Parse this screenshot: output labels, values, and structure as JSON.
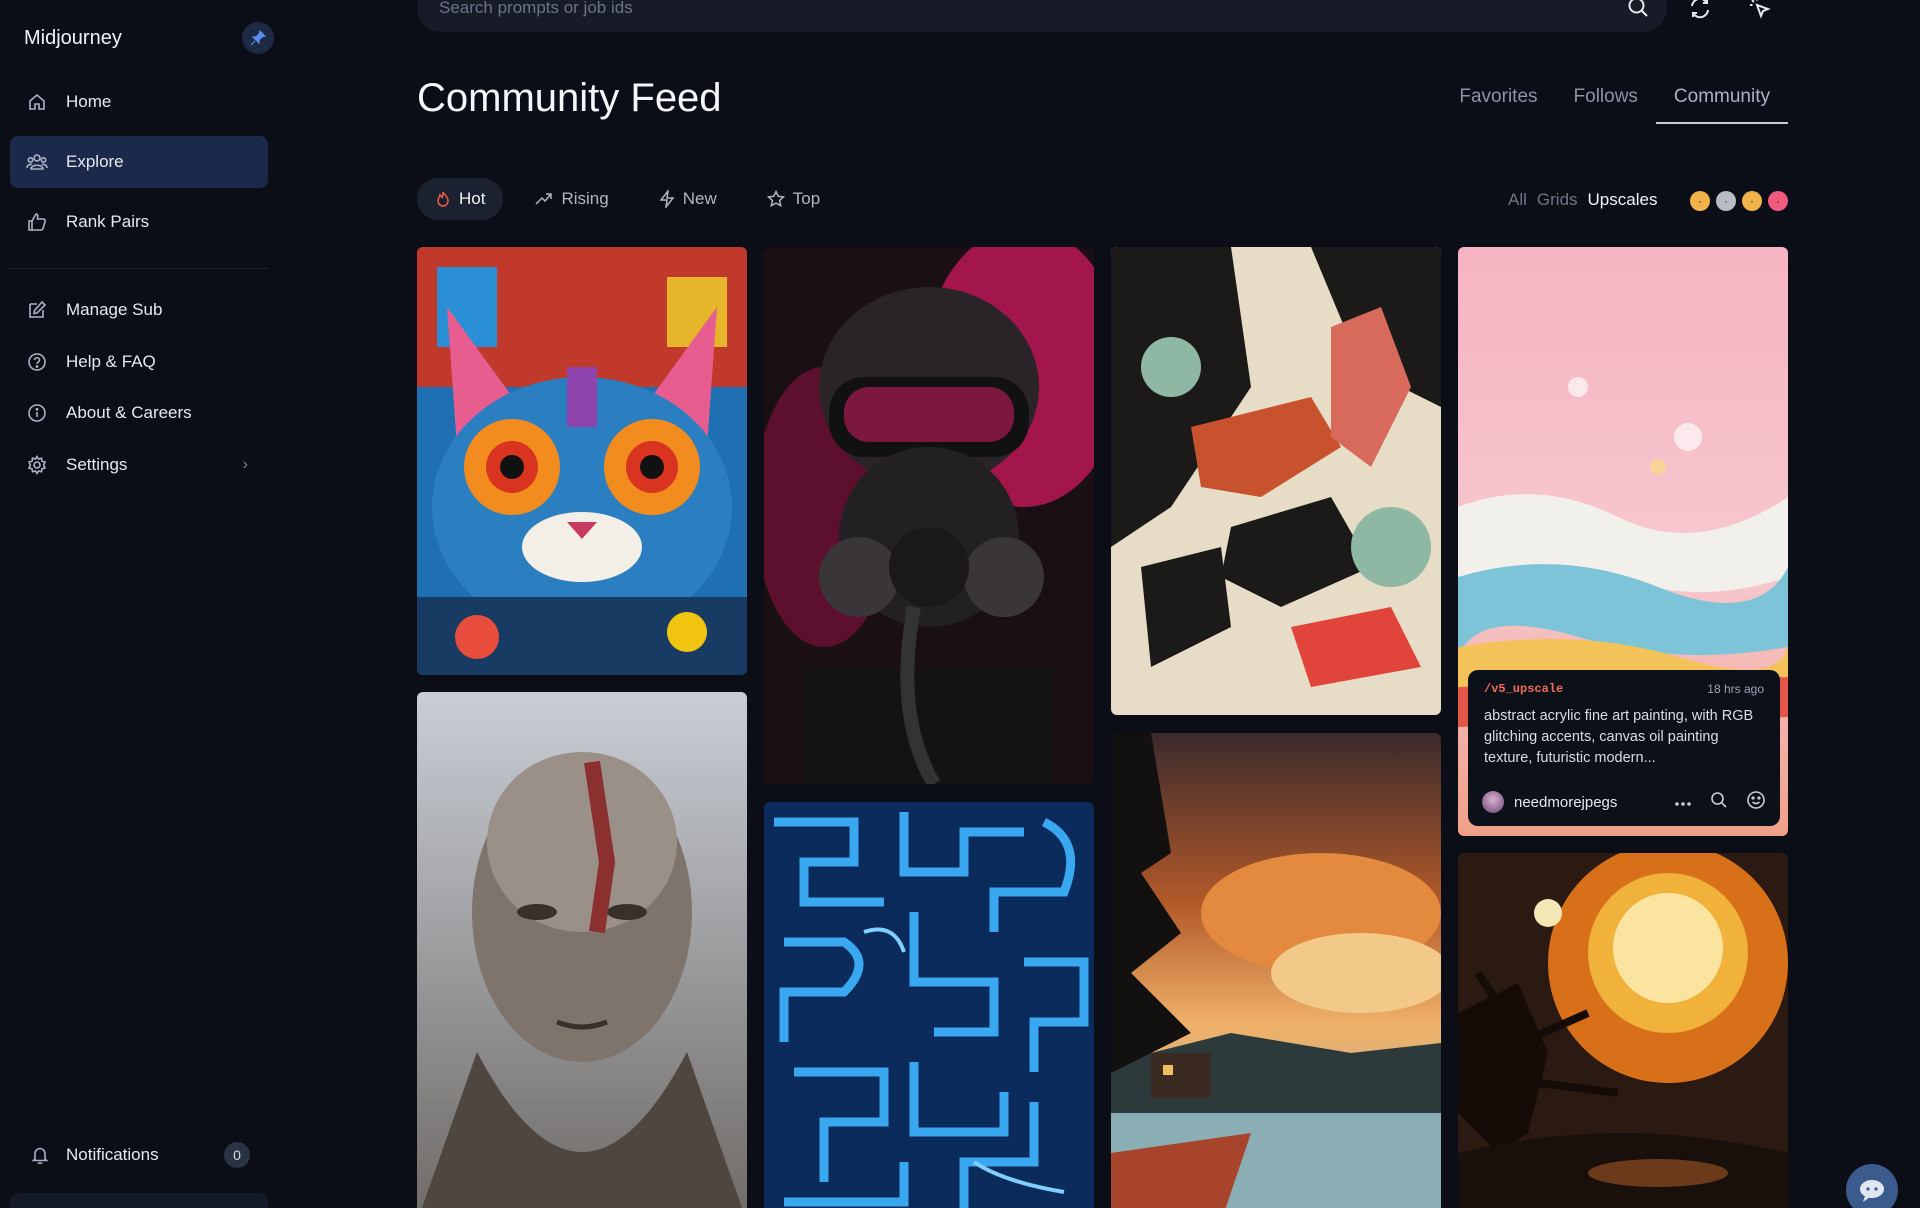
{
  "sidebar": {
    "brand": "Midjourney",
    "nav": [
      {
        "label": "Home",
        "icon": "home-icon"
      },
      {
        "label": "Explore",
        "icon": "people-icon",
        "active": true
      },
      {
        "label": "Rank Pairs",
        "icon": "thumbs-up-icon"
      }
    ],
    "nav2": [
      {
        "label": "Manage Sub",
        "icon": "edit-icon"
      },
      {
        "label": "Help & FAQ",
        "icon": "question-icon"
      },
      {
        "label": "About & Careers",
        "icon": "info-icon"
      },
      {
        "label": "Settings",
        "icon": "gear-icon"
      }
    ],
    "notifications": {
      "label": "Notifications",
      "count": "0"
    }
  },
  "search": {
    "placeholder": "Search prompts or job ids"
  },
  "header": {
    "title": "Community Feed",
    "tabs": [
      "Favorites",
      "Follows",
      "Community"
    ],
    "active_tab": "Community"
  },
  "sort": {
    "pills": [
      "Hot",
      "Rising",
      "New",
      "Top"
    ],
    "active": "Hot"
  },
  "filter": {
    "options": [
      "All",
      "Grids",
      "Upscales"
    ],
    "active": "Upscales"
  },
  "tooltip": {
    "command": "/v5_upscale",
    "time": "18 hrs ago",
    "prompt": "abstract acrylic fine art painting, with RGB glitching accents, canvas oil painting texture, futuristic modern...",
    "user": "needmorejpegs"
  },
  "colors": {
    "background": "#0b0e16",
    "active_nav": "#1b2a4a",
    "accent_command": "#f26b5b"
  }
}
